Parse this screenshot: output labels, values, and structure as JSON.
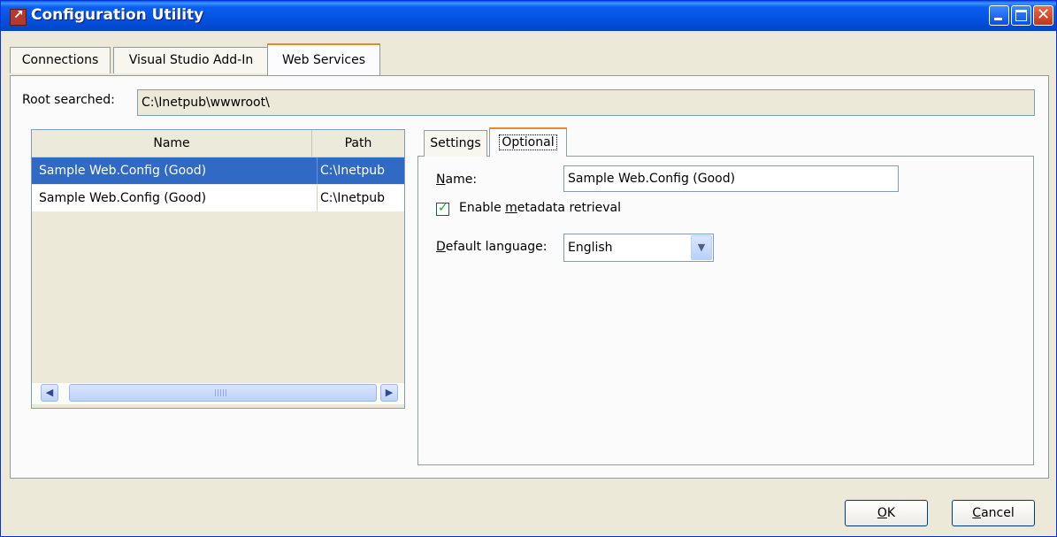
{
  "window": {
    "title": "Configuration Utility",
    "controls": {
      "minimize": "minimize",
      "maximize": "maximize",
      "close": "close"
    }
  },
  "main_tabs": [
    {
      "label": "Connections"
    },
    {
      "label": "Visual Studio Add-In"
    },
    {
      "label": "Web Services",
      "selected": true
    }
  ],
  "root": {
    "label": "Root searched:",
    "value": "C:\\Inetpub\\wwwroot\\"
  },
  "list": {
    "columns": [
      "Name",
      "Path"
    ],
    "rows": [
      {
        "name": "Sample Web.Config (Good)",
        "path": "C:\\Inetpub",
        "selected": true
      },
      {
        "name": "Sample Web.Config (Good)",
        "path": "C:\\Inetpub",
        "selected": false
      }
    ]
  },
  "detail_tabs": [
    {
      "label": "Settings"
    },
    {
      "label": "Optional",
      "selected": true
    }
  ],
  "optional": {
    "name_label_first": "N",
    "name_label_rest": "ame:",
    "name_value": "Sample Web.Config (Good)",
    "metadata_label_pre": "Enable ",
    "metadata_label_u": "m",
    "metadata_label_post": "etadata retrieval",
    "metadata_checked": true,
    "language_label_first": "D",
    "language_label_rest": "efault language:",
    "language_value": "English"
  },
  "buttons": {
    "ok_u": "O",
    "ok_rest": "K",
    "cancel_u": "C",
    "cancel_rest": "ancel"
  },
  "colors": {
    "title_bar": "#0a58e6",
    "selection": "#316ac5",
    "tab_accent": "#e68b2c",
    "check": "#21a121"
  }
}
